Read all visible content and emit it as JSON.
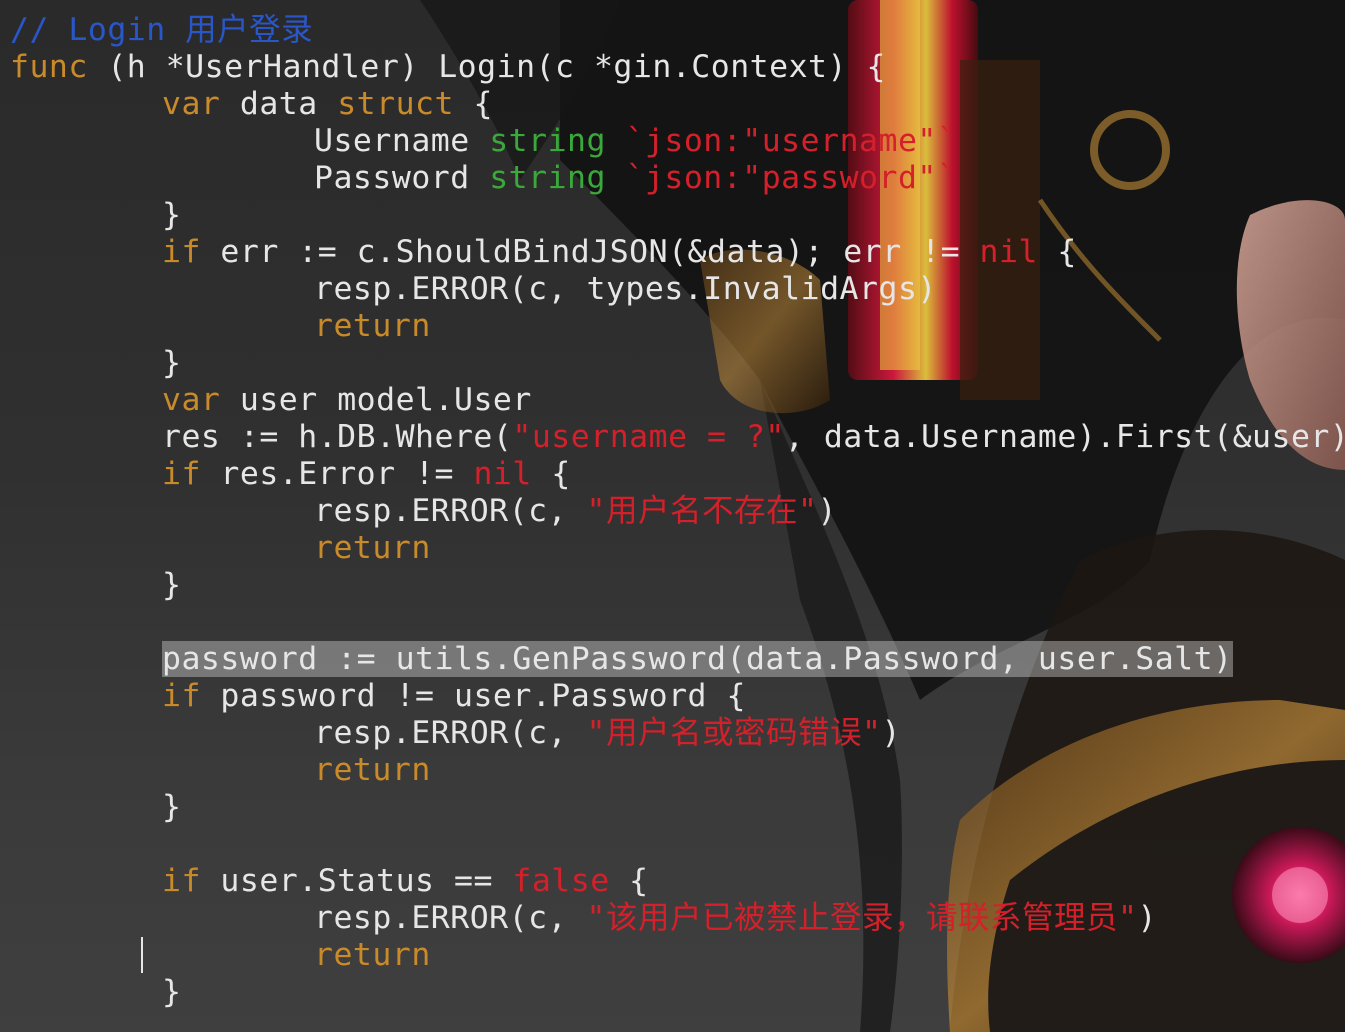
{
  "editor": {
    "lines": [
      {
        "parts": [
          {
            "c": "cm",
            "t": "// Login 用户登录"
          }
        ]
      },
      {
        "parts": [
          {
            "c": "kw",
            "t": "func"
          },
          {
            "c": "pl",
            "t": " (h *UserHandler) Login(c *gin.Context) {"
          }
        ]
      },
      {
        "indent": 1,
        "parts": [
          {
            "c": "kw",
            "t": "var"
          },
          {
            "c": "pl",
            "t": " data "
          },
          {
            "c": "kw",
            "t": "struct"
          },
          {
            "c": "pl",
            "t": " {"
          }
        ]
      },
      {
        "indent": 2,
        "parts": [
          {
            "c": "pl",
            "t": "Username "
          },
          {
            "c": "ty",
            "t": "string"
          },
          {
            "c": "pl",
            "t": " "
          },
          {
            "c": "st",
            "t": "`json:\"username\"`"
          }
        ]
      },
      {
        "indent": 2,
        "parts": [
          {
            "c": "pl",
            "t": "Password "
          },
          {
            "c": "ty",
            "t": "string"
          },
          {
            "c": "pl",
            "t": " "
          },
          {
            "c": "st",
            "t": "`json:\"password\"`"
          }
        ]
      },
      {
        "indent": 1,
        "parts": [
          {
            "c": "pl",
            "t": "}"
          }
        ]
      },
      {
        "indent": 1,
        "parts": [
          {
            "c": "kw",
            "t": "if"
          },
          {
            "c": "pl",
            "t": " err := c.ShouldBindJSON(&data); err != "
          },
          {
            "c": "nl",
            "t": "nil"
          },
          {
            "c": "pl",
            "t": " {"
          }
        ]
      },
      {
        "indent": 2,
        "parts": [
          {
            "c": "pl",
            "t": "resp.ERROR(c, types.InvalidArgs)"
          }
        ]
      },
      {
        "indent": 2,
        "parts": [
          {
            "c": "kw",
            "t": "return"
          }
        ]
      },
      {
        "indent": 1,
        "parts": [
          {
            "c": "pl",
            "t": "}"
          }
        ]
      },
      {
        "indent": 1,
        "parts": [
          {
            "c": "kw",
            "t": "var"
          },
          {
            "c": "pl",
            "t": " user model.User"
          }
        ]
      },
      {
        "indent": 1,
        "parts": [
          {
            "c": "pl",
            "t": "res := h.DB.Where("
          },
          {
            "c": "st",
            "t": "\"username = ?\""
          },
          {
            "c": "pl",
            "t": ", data.Username).First(&user)"
          }
        ]
      },
      {
        "indent": 1,
        "parts": [
          {
            "c": "kw",
            "t": "if"
          },
          {
            "c": "pl",
            "t": " res.Error != "
          },
          {
            "c": "nl",
            "t": "nil"
          },
          {
            "c": "pl",
            "t": " {"
          }
        ]
      },
      {
        "indent": 2,
        "parts": [
          {
            "c": "pl",
            "t": "resp.ERROR(c, "
          },
          {
            "c": "st",
            "t": "\"用户名不存在\""
          },
          {
            "c": "pl",
            "t": ")"
          }
        ]
      },
      {
        "indent": 2,
        "parts": [
          {
            "c": "kw",
            "t": "return"
          }
        ]
      },
      {
        "indent": 1,
        "parts": [
          {
            "c": "pl",
            "t": "}"
          }
        ]
      },
      {
        "parts": []
      },
      {
        "indent": 1,
        "highlight": true,
        "parts": [
          {
            "c": "pl",
            "t": "password := utils.GenPassword(data.Password, user.Salt)"
          }
        ]
      },
      {
        "indent": 1,
        "parts": [
          {
            "c": "kw",
            "t": "if"
          },
          {
            "c": "pl",
            "t": " password != user.Password {"
          }
        ]
      },
      {
        "indent": 2,
        "parts": [
          {
            "c": "pl",
            "t": "resp.ERROR(c, "
          },
          {
            "c": "st",
            "t": "\"用户名或密码错误\""
          },
          {
            "c": "pl",
            "t": ")"
          }
        ]
      },
      {
        "indent": 2,
        "parts": [
          {
            "c": "kw",
            "t": "return"
          }
        ]
      },
      {
        "indent": 1,
        "parts": [
          {
            "c": "pl",
            "t": "}"
          }
        ]
      },
      {
        "parts": []
      },
      {
        "indent": 1,
        "parts": [
          {
            "c": "kw",
            "t": "if"
          },
          {
            "c": "pl",
            "t": " user.Status == "
          },
          {
            "c": "nl",
            "t": "false"
          },
          {
            "c": "pl",
            "t": " {"
          }
        ]
      },
      {
        "indent": 2,
        "parts": [
          {
            "c": "pl",
            "t": "resp.ERROR(c, "
          },
          {
            "c": "st",
            "t": "\"该用户已被禁止登录，请联系管理员\""
          },
          {
            "c": "pl",
            "t": ")"
          }
        ]
      },
      {
        "indent": 2,
        "parts": [
          {
            "c": "kw",
            "t": "return"
          }
        ]
      },
      {
        "indent": 1,
        "parts": [
          {
            "c": "pl",
            "t": "}"
          }
        ]
      }
    ]
  },
  "colors": {
    "comment": "#2956c9",
    "keyword": "#c98a2a",
    "type": "#3aa83a",
    "string": "#d4202a",
    "text": "#e6e6e6",
    "background": "#2b2b2b"
  }
}
